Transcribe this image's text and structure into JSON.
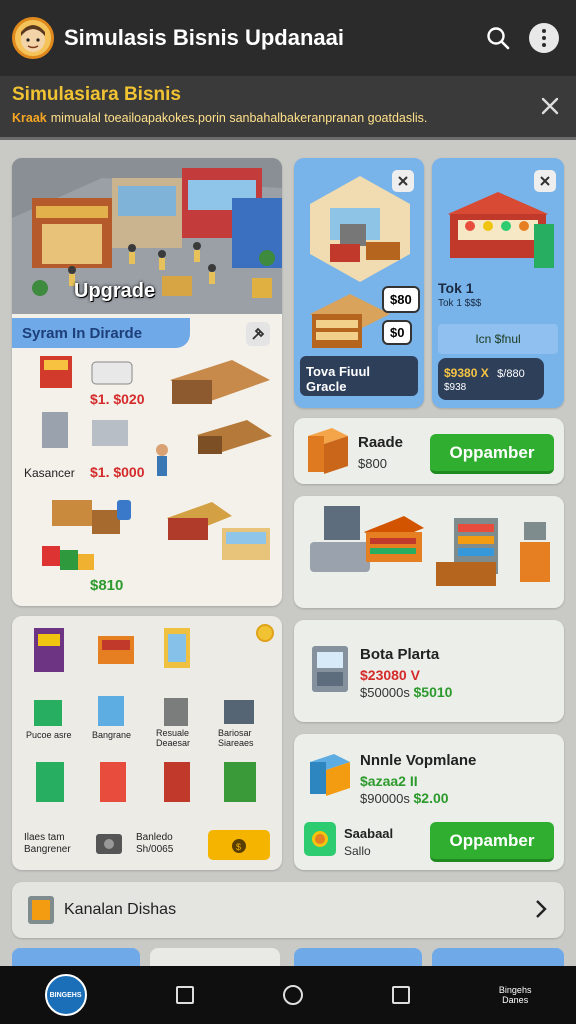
{
  "app": {
    "title": "Simulasis Bisnis Updanaai",
    "avatar_icon": "character-face-icon"
  },
  "banner": {
    "title": "Simulasiara Bisnis",
    "tag": "Kraak",
    "text": "mimualal toeailoapakokes.porin sanbahalbakeranpranan goatdaslis."
  },
  "cards": {
    "upgrade": {
      "overlay_label": "Upgrade",
      "panel_title": "Syram In Dirarde",
      "price1": "$1. $020",
      "price2": "$1. $000",
      "item_label": "Kasancer",
      "price3": "$810"
    },
    "store1": {
      "label": "Tova Fiuul Gracle",
      "badge1": "$80",
      "badge2": "$0"
    },
    "store2": {
      "label": "Tok 1",
      "sub": "Tok 1 $$$",
      "tag": "Icn $fnul",
      "price": "$9380 X",
      "price2": "$/880",
      "price3": "$938"
    },
    "product_a": {
      "name": "Raade",
      "price": "$800",
      "button": "Oppamber"
    },
    "market": {},
    "items_grid": {
      "labels": [
        "Pucoe asre",
        "Bangrane",
        "Resuale\nDeaesar",
        "Bariosar\nSiareaes"
      ],
      "footer_left": "Ilaes tam\nBangrener",
      "footer_mid": "Banledo\nSh/0065"
    },
    "product_b": {
      "name": "Bota Plarta",
      "price_red": "$23080 V",
      "price_old": "$50000s",
      "price_new": "$5010"
    },
    "product_c": {
      "name": "Nnnle Vopmlane",
      "price_green": "$azaa2 II",
      "price_old": "$90000s",
      "price_new": "$2.00",
      "sub_name": "Saabaal",
      "sub_price": "Sallo",
      "button": "Oppamber"
    },
    "collection": {
      "label": "Kanalan Dishas"
    }
  },
  "nav": {
    "brand": "Bingehs\nDanes",
    "logo_text": "BINGEHS"
  },
  "colors": {
    "accent": "#2fae2f",
    "banner_title": "#f1c232",
    "price_red": "#d52b2b",
    "appbar": "#2b2b2b"
  }
}
